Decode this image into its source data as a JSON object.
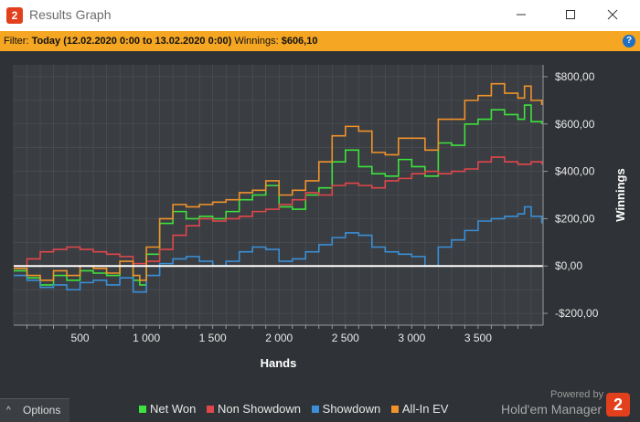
{
  "window": {
    "title": "Results Graph",
    "app_icon_text": "2"
  },
  "filter": {
    "prefix": "Filter:",
    "value": "Today (12.02.2020 0:00 to 13.02.2020 0:00)",
    "winnings_label": "Winnings:",
    "winnings_value": "$606,10",
    "help_text": "?"
  },
  "options": {
    "label": "Options",
    "chevron": "^"
  },
  "powered": {
    "line1": "Powered by",
    "line2": "Hold'em Manager",
    "logo_text": "2"
  },
  "colors": {
    "net_won": "#3ee23e",
    "non_showdown": "#e0474b",
    "showdown": "#3a8fd6",
    "allin_ev": "#f0932b",
    "zero_line": "#ffffff",
    "plot_bg": "#3a3d41",
    "grid": "#54575b"
  },
  "chart_data": {
    "type": "line",
    "xlabel": "Hands",
    "ylabel": "Winnings",
    "xlim": [
      0,
      3990
    ],
    "ylim": [
      -250,
      850
    ],
    "x_ticks": [
      500,
      1000,
      1500,
      2000,
      2500,
      3000,
      3500
    ],
    "x_tick_labels": [
      "500",
      "1 000",
      "1 500",
      "2 000",
      "2 500",
      "3 000",
      "3 500"
    ],
    "y_ticks": [
      800,
      600,
      400,
      200,
      0,
      -200
    ],
    "y_tick_labels": [
      "$800,00",
      "$600,00",
      "$400,00",
      "$200,00",
      "$0,00",
      "-$200,00"
    ],
    "grid": true,
    "legend_position": "bottom",
    "series": [
      {
        "name": "Net Won",
        "color": "#3ee23e",
        "points": [
          [
            0,
            -20
          ],
          [
            100,
            -50
          ],
          [
            200,
            -80
          ],
          [
            300,
            -40
          ],
          [
            400,
            -60
          ],
          [
            500,
            -20
          ],
          [
            600,
            -30
          ],
          [
            700,
            -40
          ],
          [
            800,
            0
          ],
          [
            900,
            -60
          ],
          [
            950,
            -80
          ],
          [
            1000,
            50
          ],
          [
            1100,
            180
          ],
          [
            1200,
            230
          ],
          [
            1300,
            200
          ],
          [
            1400,
            210
          ],
          [
            1500,
            200
          ],
          [
            1600,
            230
          ],
          [
            1700,
            280
          ],
          [
            1800,
            300
          ],
          [
            1900,
            340
          ],
          [
            2000,
            250
          ],
          [
            2100,
            240
          ],
          [
            2200,
            300
          ],
          [
            2300,
            330
          ],
          [
            2400,
            440
          ],
          [
            2500,
            490
          ],
          [
            2600,
            420
          ],
          [
            2700,
            390
          ],
          [
            2800,
            380
          ],
          [
            2900,
            450
          ],
          [
            3000,
            420
          ],
          [
            3100,
            380
          ],
          [
            3200,
            520
          ],
          [
            3300,
            510
          ],
          [
            3400,
            600
          ],
          [
            3500,
            620
          ],
          [
            3600,
            660
          ],
          [
            3700,
            640
          ],
          [
            3800,
            620
          ],
          [
            3850,
            680
          ],
          [
            3900,
            610
          ],
          [
            3980,
            600
          ]
        ]
      },
      {
        "name": "Non Showdown",
        "color": "#e0474b",
        "points": [
          [
            0,
            0
          ],
          [
            100,
            30
          ],
          [
            200,
            60
          ],
          [
            300,
            70
          ],
          [
            400,
            80
          ],
          [
            500,
            70
          ],
          [
            600,
            60
          ],
          [
            700,
            50
          ],
          [
            800,
            40
          ],
          [
            900,
            10
          ],
          [
            1000,
            20
          ],
          [
            1100,
            70
          ],
          [
            1200,
            130
          ],
          [
            1300,
            170
          ],
          [
            1400,
            200
          ],
          [
            1500,
            190
          ],
          [
            1600,
            200
          ],
          [
            1700,
            210
          ],
          [
            1800,
            230
          ],
          [
            1900,
            240
          ],
          [
            2000,
            260
          ],
          [
            2100,
            280
          ],
          [
            2200,
            310
          ],
          [
            2300,
            300
          ],
          [
            2400,
            340
          ],
          [
            2500,
            350
          ],
          [
            2600,
            340
          ],
          [
            2700,
            330
          ],
          [
            2800,
            360
          ],
          [
            2900,
            370
          ],
          [
            3000,
            390
          ],
          [
            3100,
            400
          ],
          [
            3200,
            390
          ],
          [
            3300,
            400
          ],
          [
            3400,
            410
          ],
          [
            3500,
            440
          ],
          [
            3600,
            460
          ],
          [
            3700,
            440
          ],
          [
            3800,
            430
          ],
          [
            3900,
            440
          ],
          [
            3980,
            430
          ]
        ]
      },
      {
        "name": "Showdown",
        "color": "#3a8fd6",
        "points": [
          [
            0,
            -40
          ],
          [
            100,
            -60
          ],
          [
            200,
            -90
          ],
          [
            300,
            -80
          ],
          [
            400,
            -100
          ],
          [
            500,
            -70
          ],
          [
            600,
            -60
          ],
          [
            700,
            -80
          ],
          [
            800,
            -50
          ],
          [
            900,
            -110
          ],
          [
            1000,
            -40
          ],
          [
            1100,
            10
          ],
          [
            1200,
            30
          ],
          [
            1300,
            40
          ],
          [
            1400,
            20
          ],
          [
            1500,
            0
          ],
          [
            1600,
            20
          ],
          [
            1700,
            60
          ],
          [
            1800,
            80
          ],
          [
            1900,
            70
          ],
          [
            2000,
            20
          ],
          [
            2100,
            30
          ],
          [
            2200,
            60
          ],
          [
            2300,
            90
          ],
          [
            2400,
            120
          ],
          [
            2500,
            140
          ],
          [
            2600,
            130
          ],
          [
            2700,
            80
          ],
          [
            2800,
            60
          ],
          [
            2900,
            50
          ],
          [
            3000,
            40
          ],
          [
            3100,
            0
          ],
          [
            3200,
            80
          ],
          [
            3300,
            110
          ],
          [
            3400,
            150
          ],
          [
            3500,
            190
          ],
          [
            3600,
            200
          ],
          [
            3700,
            210
          ],
          [
            3800,
            220
          ],
          [
            3850,
            250
          ],
          [
            3900,
            210
          ],
          [
            3980,
            180
          ]
        ]
      },
      {
        "name": "All-In EV",
        "color": "#f0932b",
        "points": [
          [
            0,
            -10
          ],
          [
            100,
            -40
          ],
          [
            200,
            -60
          ],
          [
            300,
            -20
          ],
          [
            400,
            -40
          ],
          [
            500,
            0
          ],
          [
            600,
            -10
          ],
          [
            700,
            -30
          ],
          [
            800,
            20
          ],
          [
            900,
            -40
          ],
          [
            950,
            -60
          ],
          [
            1000,
            80
          ],
          [
            1100,
            200
          ],
          [
            1200,
            260
          ],
          [
            1300,
            250
          ],
          [
            1400,
            260
          ],
          [
            1500,
            270
          ],
          [
            1600,
            280
          ],
          [
            1700,
            310
          ],
          [
            1800,
            320
          ],
          [
            1900,
            360
          ],
          [
            2000,
            300
          ],
          [
            2100,
            320
          ],
          [
            2200,
            360
          ],
          [
            2300,
            440
          ],
          [
            2400,
            550
          ],
          [
            2500,
            590
          ],
          [
            2600,
            570
          ],
          [
            2700,
            480
          ],
          [
            2800,
            470
          ],
          [
            2900,
            540
          ],
          [
            3000,
            540
          ],
          [
            3100,
            490
          ],
          [
            3200,
            620
          ],
          [
            3300,
            620
          ],
          [
            3400,
            700
          ],
          [
            3500,
            720
          ],
          [
            3600,
            770
          ],
          [
            3700,
            730
          ],
          [
            3800,
            710
          ],
          [
            3850,
            760
          ],
          [
            3900,
            700
          ],
          [
            3980,
            680
          ]
        ]
      }
    ]
  }
}
